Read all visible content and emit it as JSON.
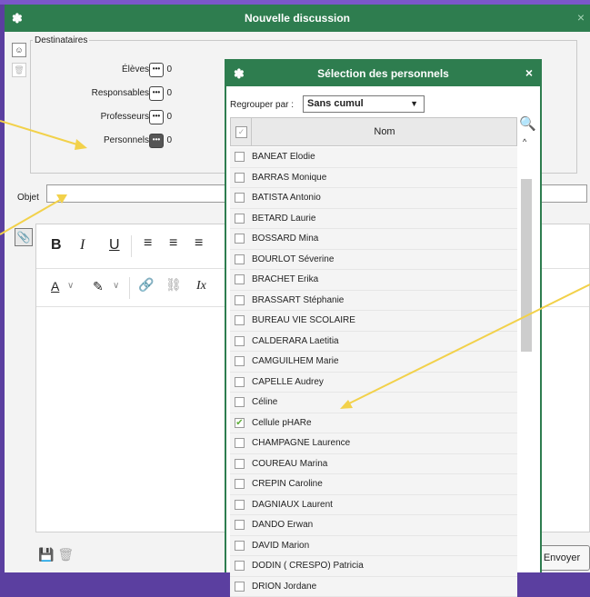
{
  "main": {
    "title": "Nouvelle discussion",
    "destinataires_legend": "Destinataires",
    "recipients": [
      {
        "label": "Élèves",
        "count": "0"
      },
      {
        "label": "Responsables",
        "count": "0"
      },
      {
        "label": "Professeurs",
        "count": "0"
      },
      {
        "label": "Personnels",
        "count": "0"
      }
    ],
    "dots_label": "•••",
    "objet_label": "Objet",
    "objet_value": "",
    "send_label": "Envoyer"
  },
  "toolbar": {
    "bold": "B",
    "italic": "I",
    "underline": "U",
    "align_left": "≡",
    "align_center": "≡",
    "align_right": "≡",
    "text_color": "A",
    "highlight": "✎",
    "link": "🔗",
    "unlink": "⛓",
    "clear_format": "Ix"
  },
  "modal": {
    "title": "Sélection des personnels",
    "close": "×",
    "group_label": "Regrouper par :",
    "group_value": "Sans cumul",
    "col_header": "Nom",
    "rows": [
      {
        "name": "BANEAT Elodie",
        "checked": false
      },
      {
        "name": "BARRAS Monique",
        "checked": false
      },
      {
        "name": "BATISTA Antonio",
        "checked": false
      },
      {
        "name": "BETARD Laurie",
        "checked": false
      },
      {
        "name": "BOSSARD Mina",
        "checked": false
      },
      {
        "name": "BOURLOT Séverine",
        "checked": false
      },
      {
        "name": "BRACHET Erika",
        "checked": false
      },
      {
        "name": "BRASSART Stéphanie",
        "checked": false
      },
      {
        "name": "BUREAU VIE SCOLAIRE",
        "checked": false
      },
      {
        "name": "CALDERARA Laetitia",
        "checked": false
      },
      {
        "name": "CAMGUILHEM Marie",
        "checked": false
      },
      {
        "name": "CAPELLE Audrey",
        "checked": false
      },
      {
        "name": "Céline",
        "checked": false
      },
      {
        "name": "Cellule pHARe",
        "checked": true
      },
      {
        "name": "CHAMPAGNE Laurence",
        "checked": false
      },
      {
        "name": "COUREAU Marina",
        "checked": false
      },
      {
        "name": "CREPIN Caroline",
        "checked": false
      },
      {
        "name": "DAGNIAUX Laurent",
        "checked": false
      },
      {
        "name": "DANDO Erwan",
        "checked": false
      },
      {
        "name": "DAVID Marion",
        "checked": false
      },
      {
        "name": "DODIN ( CRESPO) Patricia",
        "checked": false
      },
      {
        "name": "DRION Jordane",
        "checked": false
      }
    ]
  },
  "colors": {
    "green": "#2e7d4f",
    "arrow": "#f2d14a",
    "frame": "#5b3fa0"
  }
}
